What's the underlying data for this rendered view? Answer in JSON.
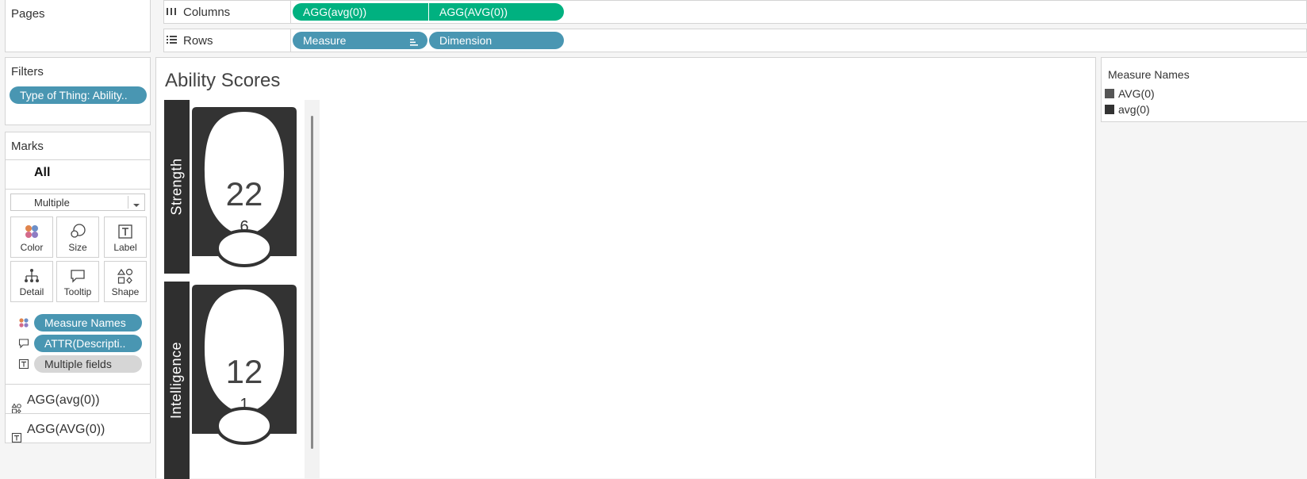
{
  "pages": {
    "title": "Pages"
  },
  "columns": {
    "label": "Columns",
    "pills": [
      "AGG(avg(0))",
      "AGG(AVG(0))"
    ]
  },
  "rows": {
    "label": "Rows",
    "pills": [
      "Measure",
      "Dimension"
    ]
  },
  "filters": {
    "title": "Filters",
    "pills": [
      "Type of Thing: Ability.."
    ]
  },
  "marks": {
    "title": "Marks",
    "all_label": "All",
    "mark_type": "Multiple",
    "buttons": [
      "Color",
      "Size",
      "Label",
      "Detail",
      "Tooltip",
      "Shape"
    ],
    "encodings": [
      "Measure Names",
      "ATTR(Descripti..",
      "Multiple fields"
    ],
    "measures": [
      "AGG(avg(0))",
      "AGG(AVG(0))"
    ]
  },
  "viz": {
    "title": "Ability Scores",
    "rows": [
      {
        "header": "Strength",
        "score": "22",
        "modifier": "6"
      },
      {
        "header": "Intelligence",
        "score": "12",
        "modifier": "1"
      }
    ]
  },
  "legend": {
    "title": "Measure Names",
    "items": [
      {
        "label": "AVG(0)",
        "color": "#555555"
      },
      {
        "label": "avg(0)",
        "color": "#333333"
      }
    ]
  },
  "colors": {
    "pill_blue": "#4996b2",
    "pill_green": "#00b180",
    "header_dark": "#2f2f2f"
  }
}
